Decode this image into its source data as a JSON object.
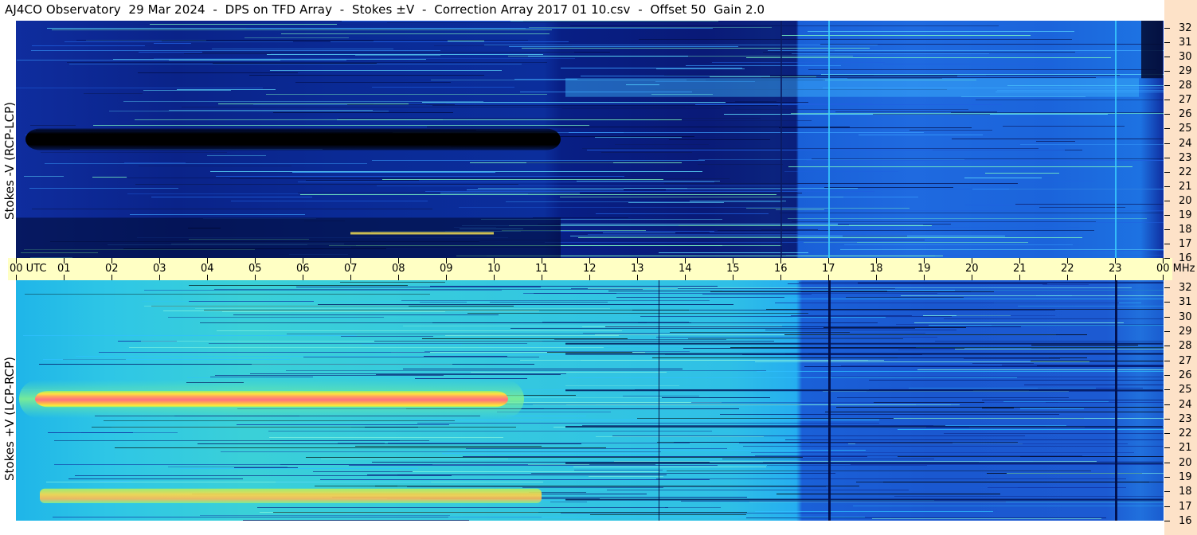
{
  "title": "AJ4CO Observatory  29 Mar 2024  -  DPS on TFD Array  -  Stokes ±V  -  Correction Array 2017 01 10.csv  -  Offset 50  Gain 2.0",
  "chart_data": [
    {
      "type": "heatmap",
      "panel": "top",
      "ylabel": "Stokes -V (RCP-LCP)",
      "x_ticks": [
        "00 UTC",
        "01",
        "02",
        "03",
        "04",
        "05",
        "06",
        "07",
        "08",
        "09",
        "10",
        "11",
        "12",
        "13",
        "14",
        "15",
        "16",
        "17",
        "18",
        "19",
        "20",
        "21",
        "22",
        "23",
        "00 MHz"
      ],
      "y_ticks": [
        "32",
        "31",
        "30",
        "29",
        "28",
        "27",
        "26",
        "25",
        "24",
        "23",
        "22",
        "21",
        "20",
        "19",
        "18",
        "17",
        "16"
      ],
      "xlim_hours": [
        0,
        24
      ],
      "ylim_mhz": [
        16,
        32.5
      ],
      "features": [
        {
          "desc": "dark band",
          "x_hours": [
            0.2,
            11.4
          ],
          "y_mhz": [
            23.5,
            25.0
          ],
          "level": "min"
        },
        {
          "desc": "bright band",
          "x_hours": [
            11.5,
            24
          ],
          "y_mhz": [
            27.2,
            28.5
          ],
          "level": "high"
        }
      ]
    },
    {
      "type": "heatmap",
      "panel": "bottom",
      "ylabel": "Stokes +V (LCP-RCP)",
      "y_ticks": [
        "32",
        "31",
        "30",
        "29",
        "28",
        "27",
        "26",
        "25",
        "24",
        "23",
        "22",
        "21",
        "20",
        "19",
        "18",
        "17",
        "16"
      ],
      "xlim_hours": [
        0,
        24
      ],
      "ylim_mhz": [
        16,
        32.5
      ],
      "features": [
        {
          "desc": "intense band",
          "x_hours": [
            0.4,
            10.3
          ],
          "y_mhz": [
            23.8,
            24.9
          ],
          "level": "max"
        },
        {
          "desc": "warm band",
          "x_hours": [
            0.5,
            11
          ],
          "y_mhz": [
            17.2,
            18.2
          ],
          "level": "high"
        }
      ]
    }
  ],
  "colors": {
    "colormap": [
      "#000000",
      "#001070",
      "#0535c8",
      "#1a7ae8",
      "#2ab8f0",
      "#40e0c0",
      "#a0f070",
      "#ffe040",
      "#ff9060",
      "#ff60a0"
    ]
  }
}
